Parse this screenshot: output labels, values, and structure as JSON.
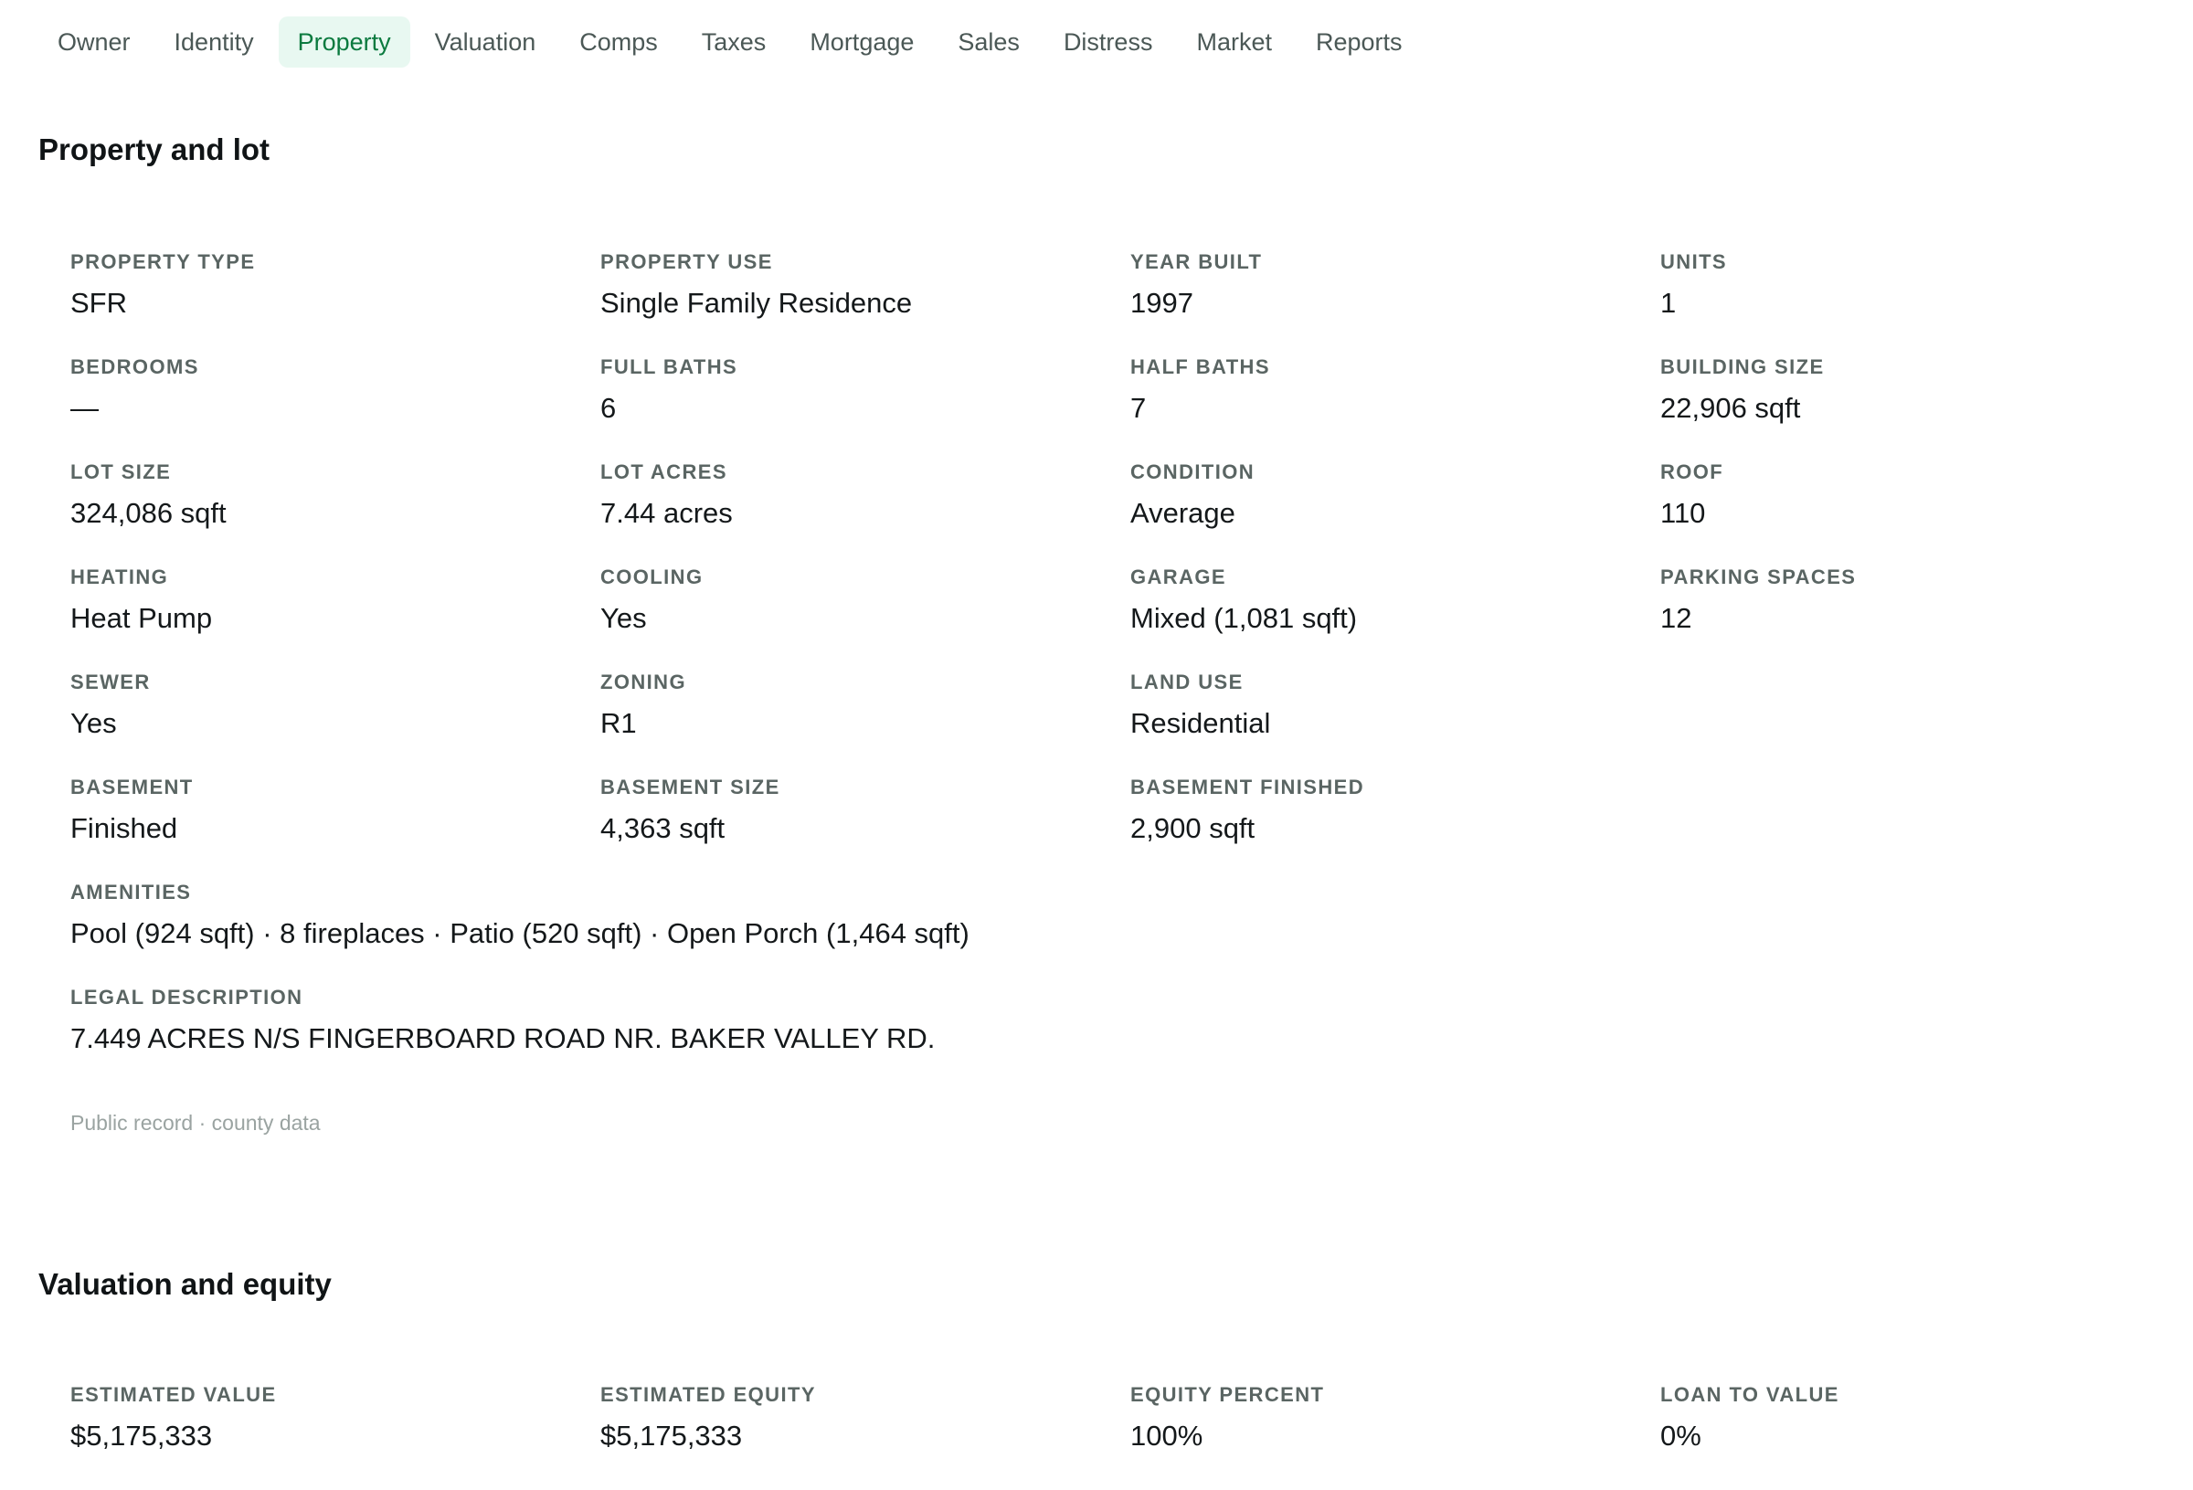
{
  "tabs": [
    {
      "label": "Owner",
      "active": false
    },
    {
      "label": "Identity",
      "active": false
    },
    {
      "label": "Property",
      "active": true
    },
    {
      "label": "Valuation",
      "active": false
    },
    {
      "label": "Comps",
      "active": false
    },
    {
      "label": "Taxes",
      "active": false
    },
    {
      "label": "Mortgage",
      "active": false
    },
    {
      "label": "Sales",
      "active": false
    },
    {
      "label": "Distress",
      "active": false
    },
    {
      "label": "Market",
      "active": false
    },
    {
      "label": "Reports",
      "active": false
    }
  ],
  "property": {
    "title": "Property and lot",
    "fields": [
      {
        "label": "PROPERTY TYPE",
        "value": "SFR"
      },
      {
        "label": "PROPERTY USE",
        "value": "Single Family Residence"
      },
      {
        "label": "YEAR BUILT",
        "value": "1997"
      },
      {
        "label": "UNITS",
        "value": "1"
      },
      {
        "label": "BEDROOMS",
        "value": "—"
      },
      {
        "label": "FULL BATHS",
        "value": "6"
      },
      {
        "label": "HALF BATHS",
        "value": "7"
      },
      {
        "label": "BUILDING SIZE",
        "value": "22,906 sqft"
      },
      {
        "label": "LOT SIZE",
        "value": "324,086 sqft"
      },
      {
        "label": "LOT ACRES",
        "value": "7.44 acres"
      },
      {
        "label": "CONDITION",
        "value": "Average"
      },
      {
        "label": "ROOF",
        "value": "110"
      },
      {
        "label": "HEATING",
        "value": "Heat Pump"
      },
      {
        "label": "COOLING",
        "value": "Yes"
      },
      {
        "label": "GARAGE",
        "value": "Mixed (1,081 sqft)"
      },
      {
        "label": "PARKING SPACES",
        "value": "12"
      },
      {
        "label": "SEWER",
        "value": "Yes"
      },
      {
        "label": "ZONING",
        "value": "R1"
      },
      {
        "label": "LAND USE",
        "value": "Residential"
      },
      {
        "label": "BASEMENT",
        "value": "Finished"
      },
      {
        "label": "BASEMENT SIZE",
        "value": "4,363 sqft"
      },
      {
        "label": "BASEMENT FINISHED",
        "value": "2,900 sqft"
      }
    ],
    "amenities": {
      "label": "AMENITIES",
      "value": "Pool (924 sqft) · 8 fireplaces · Patio (520 sqft) · Open Porch (1,464 sqft)"
    },
    "legal": {
      "label": "LEGAL DESCRIPTION",
      "value": "7.449 ACRES N/S FINGERBOARD ROAD NR. BAKER VALLEY RD."
    },
    "footnote": "Public record · county data"
  },
  "valuation": {
    "title": "Valuation and equity",
    "fields": [
      {
        "label": "ESTIMATED VALUE",
        "value": "$5,175,333"
      },
      {
        "label": "ESTIMATED EQUITY",
        "value": "$5,175,333"
      },
      {
        "label": "EQUITY PERCENT",
        "value": "100%"
      },
      {
        "label": "LOAN TO VALUE",
        "value": "0%"
      }
    ]
  }
}
